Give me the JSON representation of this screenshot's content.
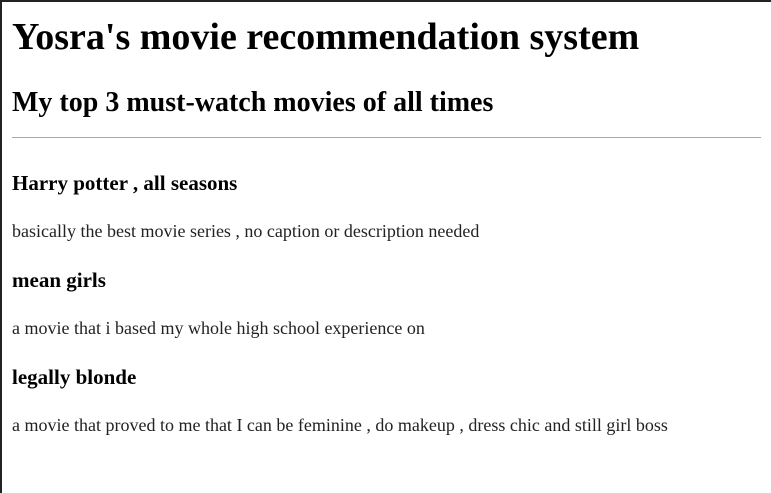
{
  "page": {
    "heading": "Yosra's movie recommendation system",
    "subheading": "My top 3 must-watch movies of all times"
  },
  "movies": [
    {
      "title": "Harry potter , all seasons",
      "description": "basically the best movie series , no caption or description needed"
    },
    {
      "title": "mean girls",
      "description": "a movie that i based my whole high school experience on"
    },
    {
      "title": "legally blonde",
      "description": "a movie that proved to me that I can be feminine , do makeup , dress chic and still girl boss"
    }
  ]
}
